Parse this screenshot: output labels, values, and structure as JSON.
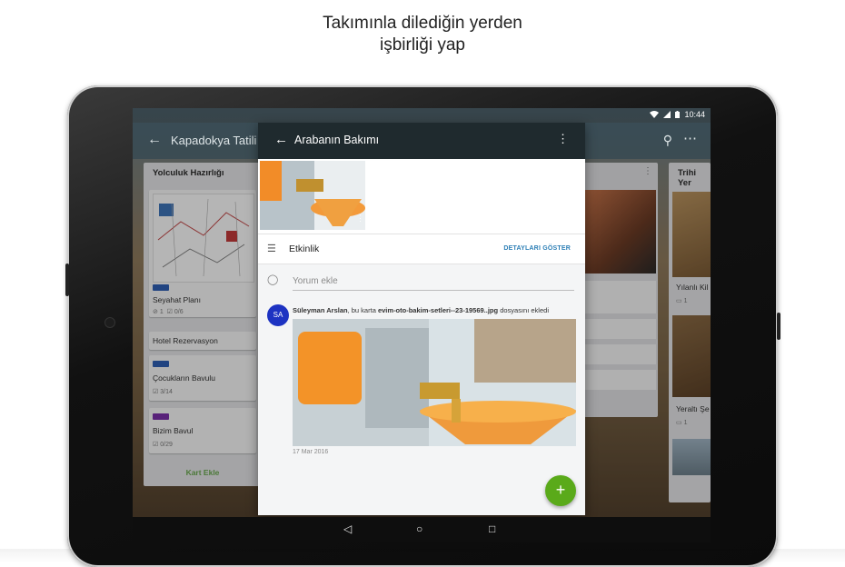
{
  "headline": {
    "line1": "Takımınla dilediğin yerden",
    "line2": "işbirliği yap"
  },
  "status": {
    "time": "10:44",
    "icons": [
      "wifi-icon",
      "signal-icon",
      "battery-icon"
    ]
  },
  "board": {
    "title": "Kapadokya Tatili",
    "actions": [
      "search-icon",
      "more-icon"
    ],
    "lists": [
      {
        "title": "Yolculuk Hazırlığı",
        "cards": [
          {
            "title": "Seyahat Planı",
            "label_color": "#2f5fb3",
            "badges": {
              "attachments": "1",
              "checklist": "0/6"
            }
          },
          {
            "title": "Hotel Rezervasyon"
          },
          {
            "title": "Çocukların Bavulu",
            "label_color": "#2f5fb3",
            "badges": {
              "checklist": "3/14"
            }
          },
          {
            "title": "Bizim Bavul",
            "label_color": "#7b2fa8",
            "badges": {
              "checklist": "0/29"
            }
          }
        ],
        "add_label": "Kart Ekle"
      },
      {
        "title": "Trihi Yer",
        "cards": [
          {
            "title": "Yılanlı Kil",
            "badges": {
              "comments": "1"
            }
          },
          {
            "title": "Yeraltı Şe",
            "badges": {
              "comments": "1"
            }
          }
        ]
      }
    ]
  },
  "card_detail": {
    "title": "Arabanın Bakımı",
    "section": {
      "title": "Etkinlik",
      "link": "DETAYLARI GÖSTER"
    },
    "comment_placeholder": "Yorum ekle",
    "activity": {
      "avatar": "SA",
      "user": "Süleyman Arslan",
      "action": ", bu karta",
      "file": "evim-oto-bakim-setleri--23-19569..jpg",
      "suffix": "dosyasını ekledi",
      "date": "17 Mar 2016"
    },
    "fab_label": "+"
  },
  "colors": {
    "fab": "#5aaa1a",
    "link": "#2d7fb6",
    "avatar": "#1d33c2"
  }
}
